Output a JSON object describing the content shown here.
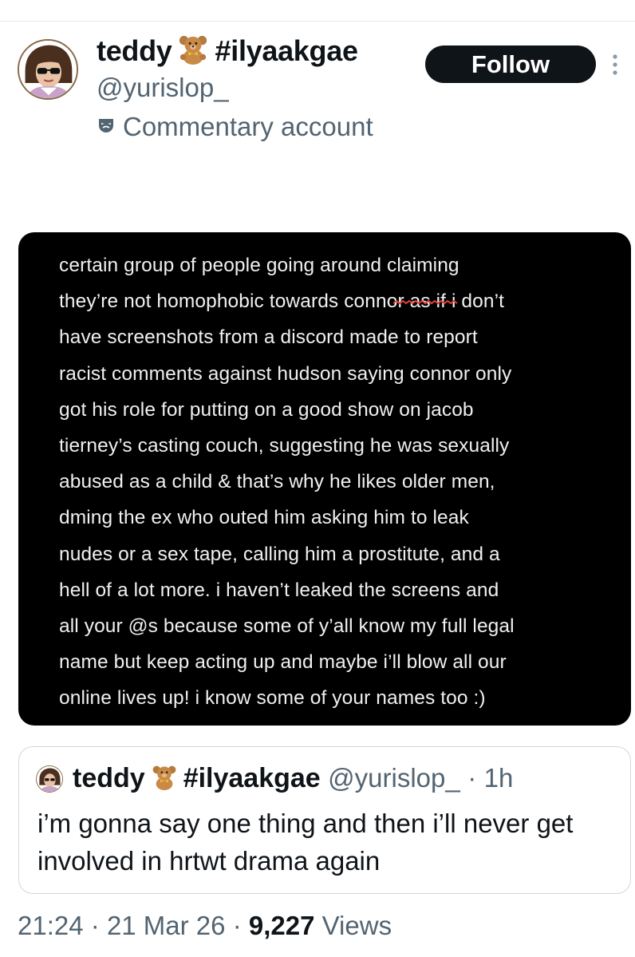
{
  "author": {
    "display_name": "teddy",
    "emoji": "teddy-bear",
    "hashtag": "#ilyaakgae",
    "handle": "@yurislop_",
    "label_icon": "mask-icon",
    "label": "Commentary account"
  },
  "follow_button": {
    "label": "Follow"
  },
  "more_icon": "vertical-dots-icon",
  "media_text": "certain group of people going around claiming\nthey’re not homophobic towards connor as if i don’t\nhave screenshots from a discord made to report\nracist comments against hudson saying connor only\ngot his role for putting on a good show on jacob\ntierney’s casting couch, suggesting he was sexually\nabused as a child & that’s why he likes older men,\ndming the ex who outed him asking him to leak\nnudes or a sex tape, calling him a prostitute, and a\nhell of a lot more. i haven’t leaked the screens and\nall your @s because some of y’all know my full legal\nname but keep acting up and maybe i’ll blow all our\nonline lives up! i know some of your names too :)",
  "quoted": {
    "display_name": "teddy",
    "hashtag": "#ilyaakgae",
    "handle": "@yurislop_",
    "separator": "·",
    "time": "1h",
    "text": "i’m gonna say one thing and then i’ll never get involved in hrtwt drama again"
  },
  "meta": {
    "time": "21:24",
    "sep1": "·",
    "date": "21 Mar 26",
    "sep2": "·",
    "views_count": "9,227",
    "views_label": "Views"
  },
  "colors": {
    "text": "#0f1419",
    "secondary": "#536471",
    "border": "#cfd9de"
  }
}
